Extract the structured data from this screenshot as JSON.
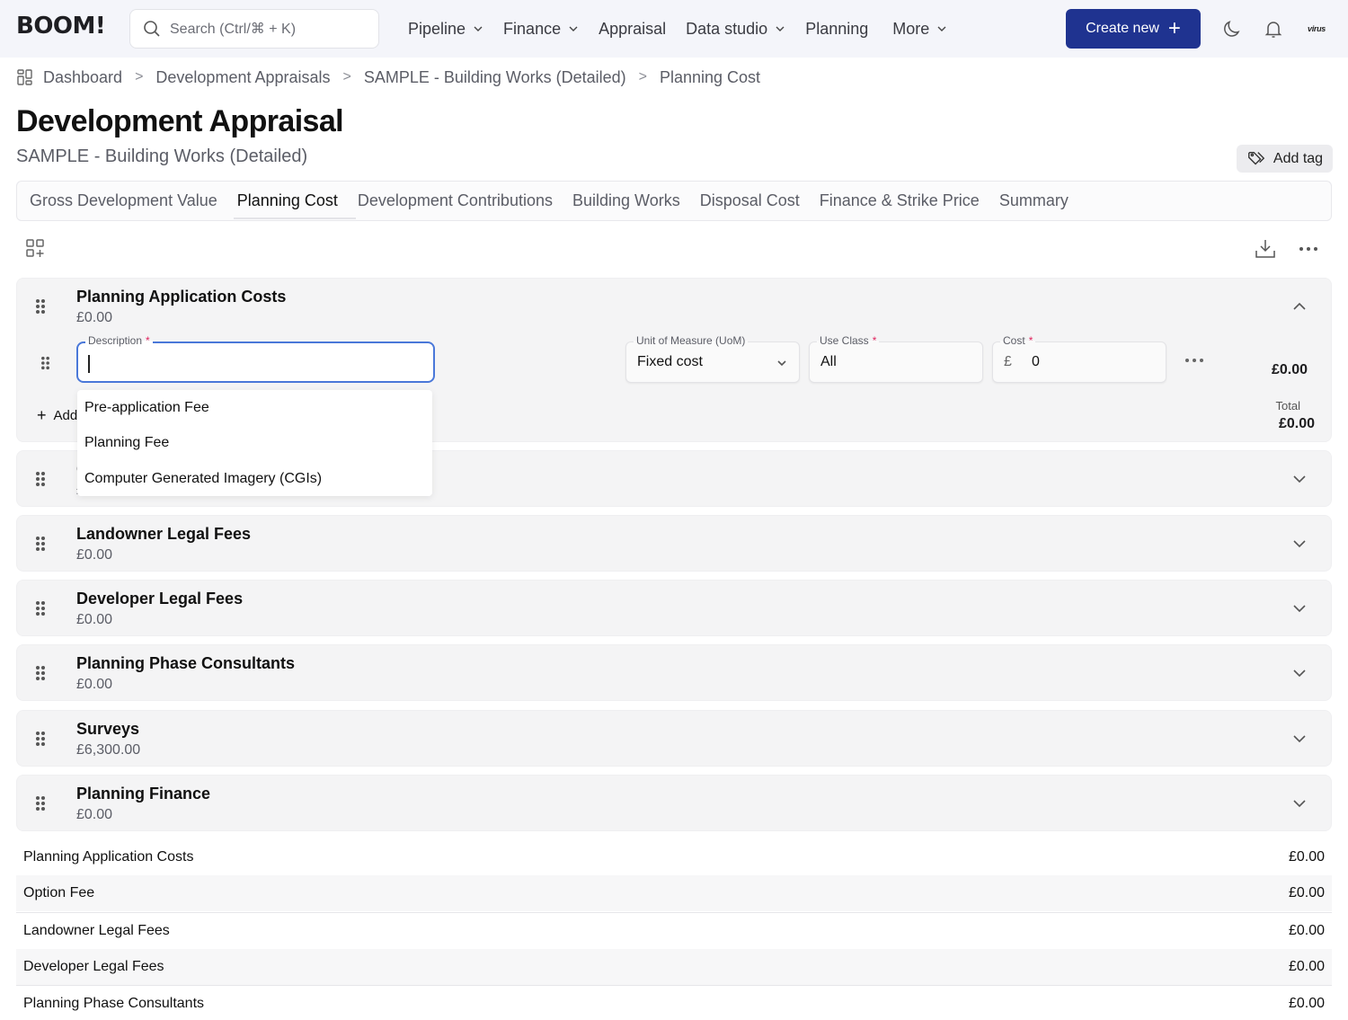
{
  "app": {
    "logo": "BOOM!",
    "search_placeholder": "Search (Ctrl/⌘ + K)",
    "nav": [
      {
        "label": "Pipeline",
        "has_dropdown": true
      },
      {
        "label": "Finance",
        "has_dropdown": true
      },
      {
        "label": "Appraisal",
        "has_dropdown": false
      },
      {
        "label": "Data studio",
        "has_dropdown": true
      },
      {
        "label": "Planning",
        "has_dropdown": false
      },
      {
        "label": "More",
        "has_dropdown": true
      }
    ],
    "create_new_label": "Create new",
    "avatar_text": "virus",
    "brand_color": "#1f3390"
  },
  "breadcrumb": [
    "Dashboard",
    "Development Appraisals",
    "SAMPLE - Building Works (Detailed)",
    "Planning Cost"
  ],
  "page": {
    "title": "Development Appraisal",
    "subtitle": "SAMPLE - Building Works (Detailed)",
    "add_tag_label": "Add tag"
  },
  "tabs": [
    {
      "label": "Gross Development Value",
      "active": false
    },
    {
      "label": "Planning Cost",
      "active": true
    },
    {
      "label": "Development Contributions",
      "active": false
    },
    {
      "label": "Building Works",
      "active": false
    },
    {
      "label": "Disposal Cost",
      "active": false
    },
    {
      "label": "Finance & Strike Price",
      "active": false
    },
    {
      "label": "Summary",
      "active": false
    }
  ],
  "expanded_section": {
    "title": "Planning Application Costs",
    "amount": "£0.00",
    "row": {
      "description_label": "Description",
      "description_value": "",
      "uom_label": "Unit of Measure (UoM)",
      "uom_value": "Fixed cost",
      "use_class_label": "Use Class",
      "use_class_value": "All",
      "cost_label": "Cost",
      "cost_currency": "£",
      "cost_value": "0",
      "row_total": "£0.00"
    },
    "add_row_label": "Add",
    "total_label": "Total",
    "total_value": "£0.00",
    "dropdown_options": [
      "Pre-application Fee",
      "Planning Fee",
      "Computer Generated Imagery (CGIs)"
    ]
  },
  "sections": [
    {
      "title": "Option Fee",
      "amount": "£0.00"
    },
    {
      "title": "Landowner Legal Fees",
      "amount": "£0.00"
    },
    {
      "title": "Developer Legal Fees",
      "amount": "£0.00"
    },
    {
      "title": "Planning Phase Consultants",
      "amount": "£0.00"
    },
    {
      "title": "Surveys",
      "amount": "£6,300.00"
    },
    {
      "title": "Planning Finance",
      "amount": "£0.00"
    }
  ],
  "summary_table": [
    {
      "label": "Planning Application Costs",
      "value": "£0.00"
    },
    {
      "label": "Option Fee",
      "value": "£0.00"
    },
    {
      "label": "Landowner Legal Fees",
      "value": "£0.00"
    },
    {
      "label": "Developer Legal Fees",
      "value": "£0.00"
    },
    {
      "label": "Planning Phase Consultants",
      "value": "£0.00"
    }
  ]
}
